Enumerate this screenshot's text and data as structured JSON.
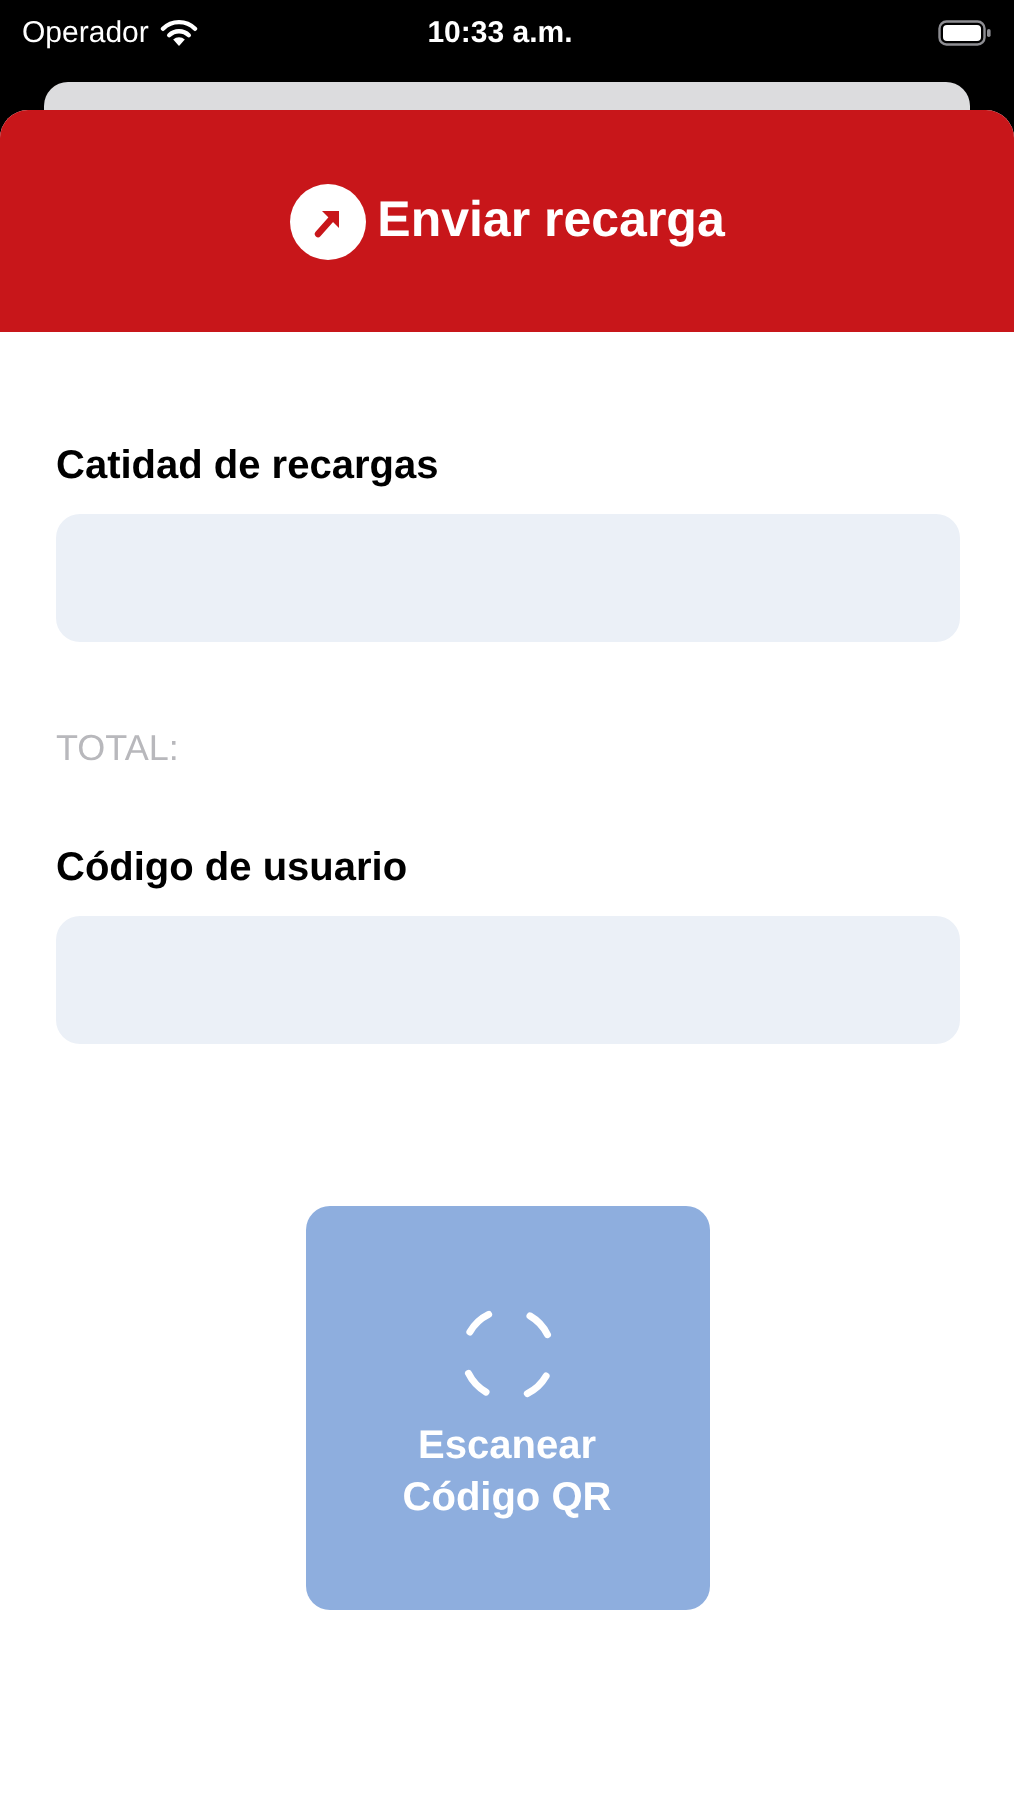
{
  "status_bar": {
    "carrier": "Operador",
    "time": "10:33 a.m."
  },
  "header": {
    "title": "Enviar recarga"
  },
  "form": {
    "fields": [
      {
        "label": "Catidad de recargas"
      },
      {
        "label": "Código de usuario"
      }
    ],
    "total": "TOTAL:"
  },
  "scan_button": {
    "label": "Escanear\nCódigo QR"
  }
}
